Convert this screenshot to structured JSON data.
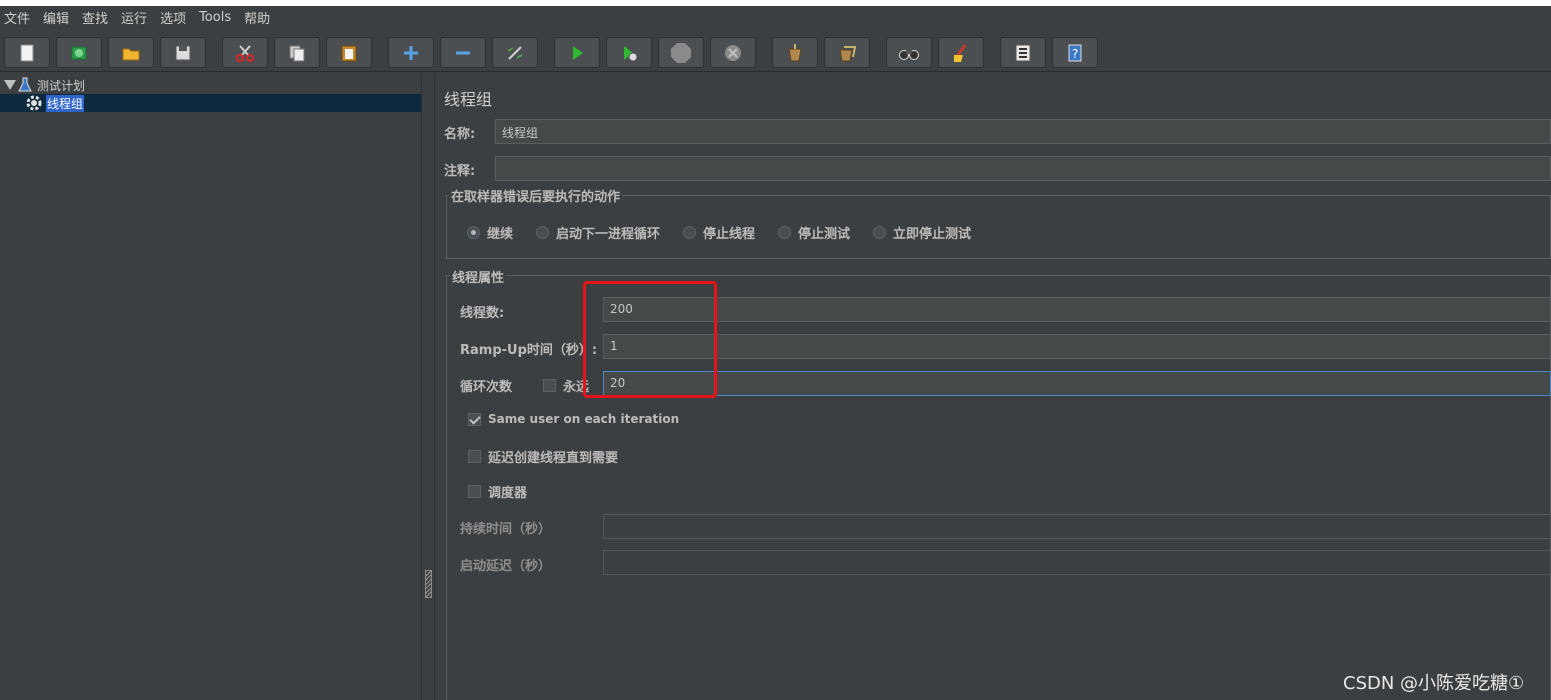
{
  "menu": [
    "文件",
    "编辑",
    "查找",
    "运行",
    "选项",
    "Tools",
    "帮助"
  ],
  "toolbar": {
    "buttons": [
      {
        "name": "new-icon"
      },
      {
        "name": "templates-icon"
      },
      {
        "name": "open-icon"
      },
      {
        "name": "save-icon"
      },
      {
        "name": "cut-icon"
      },
      {
        "name": "copy-icon"
      },
      {
        "name": "paste-icon"
      },
      {
        "name": "expand-icon"
      },
      {
        "name": "collapse-icon"
      },
      {
        "name": "toggle-icon"
      },
      {
        "name": "start-icon"
      },
      {
        "name": "start-no-pauses-icon"
      },
      {
        "name": "stop-icon"
      },
      {
        "name": "shutdown-icon"
      },
      {
        "name": "clear-icon"
      },
      {
        "name": "clear-all-icon"
      },
      {
        "name": "search-icon"
      },
      {
        "name": "reset-search-icon"
      },
      {
        "name": "function-helper-icon"
      },
      {
        "name": "help-icon"
      }
    ]
  },
  "tree": {
    "plan_label": "测试计划",
    "group_label": "线程组"
  },
  "panel": {
    "title": "线程组",
    "name_label": "名称:",
    "name_value": "线程组",
    "comment_label": "注释:",
    "comment_value": "",
    "error_action": {
      "legend": "在取样器错误后要执行的动作",
      "options": [
        "继续",
        "启动下一进程循环",
        "停止线程",
        "停止测试",
        "立即停止测试"
      ],
      "selected": "继续"
    },
    "thread_props": {
      "legend": "线程属性",
      "threads_label": "线程数:",
      "threads_value": "200",
      "rampup_label": "Ramp-Up时间（秒）:",
      "rampup_value": "1",
      "loop_label": "循环次数",
      "forever_label": "永远",
      "forever_checked": false,
      "loop_value": "20",
      "same_user_label": "Same user on each iteration",
      "same_user_checked": true,
      "delay_label": "延迟创建线程直到需要",
      "delay_checked": false,
      "scheduler_label": "调度器",
      "scheduler_checked": false,
      "duration_label": "持续时间（秒）",
      "duration_value": "",
      "startup_delay_label": "启动延迟（秒）",
      "startup_delay_value": ""
    }
  },
  "watermark": "CSDN @小陈爱吃糖①"
}
